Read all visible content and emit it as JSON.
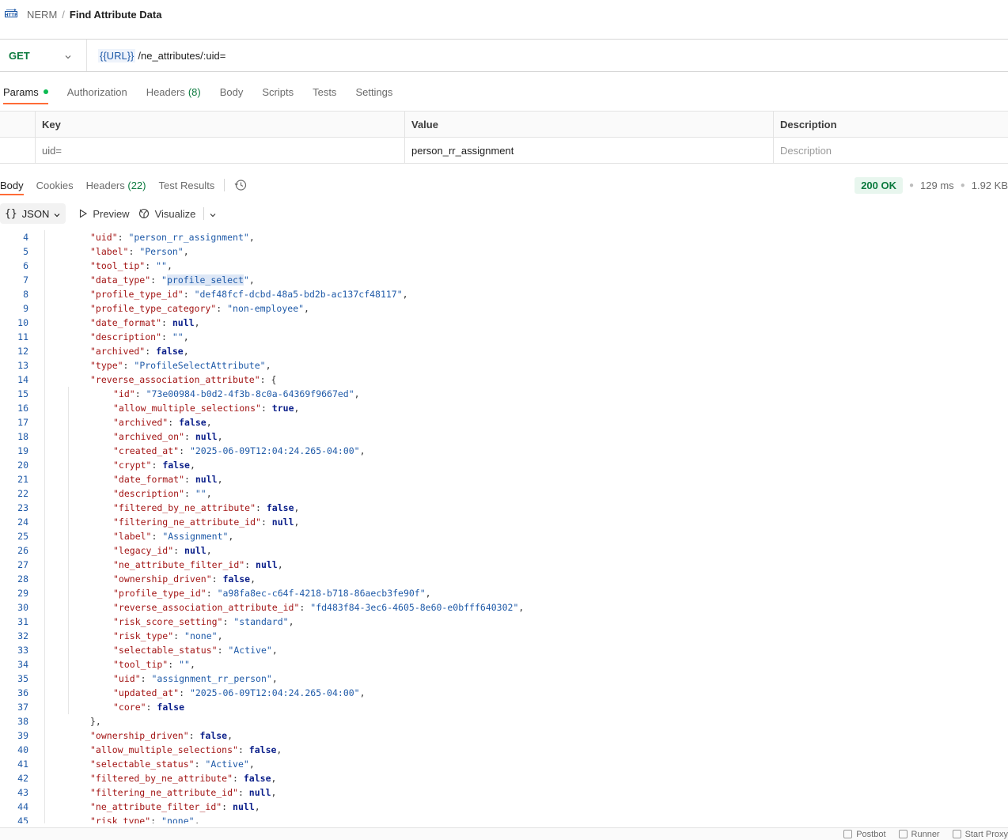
{
  "header": {
    "breadcrumb_root": "NERM",
    "breadcrumb_sep": "/",
    "title": "Find Attribute Data"
  },
  "request": {
    "method": "GET",
    "url_variable": "{{URL}}",
    "url_path": "/ne_attributes/:uid=",
    "tabs": [
      {
        "label": "Params",
        "count": "",
        "active": true,
        "dot": true
      },
      {
        "label": "Authorization",
        "count": ""
      },
      {
        "label": "Headers",
        "count": "(8)"
      },
      {
        "label": "Body",
        "count": ""
      },
      {
        "label": "Scripts",
        "count": ""
      },
      {
        "label": "Tests",
        "count": ""
      },
      {
        "label": "Settings",
        "count": ""
      }
    ]
  },
  "params": {
    "headers": {
      "key": "Key",
      "value": "Value",
      "description": "Description"
    },
    "rows": [
      {
        "key": "uid=",
        "value": "person_rr_assignment",
        "description_placeholder": "Description"
      }
    ]
  },
  "response": {
    "tabs": [
      {
        "label": "Body",
        "count": "",
        "active": true
      },
      {
        "label": "Cookies",
        "count": ""
      },
      {
        "label": "Headers",
        "count": "(22)"
      },
      {
        "label": "Test Results",
        "count": ""
      }
    ],
    "status": "200 OK",
    "time": "129 ms",
    "size": "1.92 KB",
    "format": "JSON",
    "preview_label": "Preview",
    "visualize_label": "Visualize"
  },
  "code_lines": [
    {
      "n": "4",
      "indent": 1,
      "tokens": [
        [
          "k",
          "\"uid\""
        ],
        [
          "p",
          ": "
        ],
        [
          "s",
          "\"person_rr_assignment\""
        ],
        [
          "p",
          ","
        ]
      ]
    },
    {
      "n": "5",
      "indent": 1,
      "tokens": [
        [
          "k",
          "\"label\""
        ],
        [
          "p",
          ": "
        ],
        [
          "s",
          "\"Person\""
        ],
        [
          "p",
          ","
        ]
      ]
    },
    {
      "n": "6",
      "indent": 1,
      "tokens": [
        [
          "k",
          "\"tool_tip\""
        ],
        [
          "p",
          ": "
        ],
        [
          "s",
          "\"\""
        ],
        [
          "p",
          ","
        ]
      ]
    },
    {
      "n": "7",
      "indent": 1,
      "tokens": [
        [
          "k",
          "\"data_type\""
        ],
        [
          "p",
          ": "
        ],
        [
          "s",
          "\""
        ],
        [
          "s hl",
          "profile_select"
        ],
        [
          "s",
          "\""
        ],
        [
          "p",
          ","
        ]
      ]
    },
    {
      "n": "8",
      "indent": 1,
      "tokens": [
        [
          "k",
          "\"profile_type_id\""
        ],
        [
          "p",
          ": "
        ],
        [
          "s",
          "\"def48fcf-dcbd-48a5-bd2b-ac137cf48117\""
        ],
        [
          "p",
          ","
        ]
      ]
    },
    {
      "n": "9",
      "indent": 1,
      "tokens": [
        [
          "k",
          "\"profile_type_category\""
        ],
        [
          "p",
          ": "
        ],
        [
          "s",
          "\"non-employee\""
        ],
        [
          "p",
          ","
        ]
      ]
    },
    {
      "n": "10",
      "indent": 1,
      "tokens": [
        [
          "k",
          "\"date_format\""
        ],
        [
          "p",
          ": "
        ],
        [
          "l",
          "null"
        ],
        [
          "p",
          ","
        ]
      ]
    },
    {
      "n": "11",
      "indent": 1,
      "tokens": [
        [
          "k",
          "\"description\""
        ],
        [
          "p",
          ": "
        ],
        [
          "s",
          "\"\""
        ],
        [
          "p",
          ","
        ]
      ]
    },
    {
      "n": "12",
      "indent": 1,
      "tokens": [
        [
          "k",
          "\"archived\""
        ],
        [
          "p",
          ": "
        ],
        [
          "l",
          "false"
        ],
        [
          "p",
          ","
        ]
      ]
    },
    {
      "n": "13",
      "indent": 1,
      "tokens": [
        [
          "k",
          "\"type\""
        ],
        [
          "p",
          ": "
        ],
        [
          "s",
          "\"ProfileSelectAttribute\""
        ],
        [
          "p",
          ","
        ]
      ]
    },
    {
      "n": "14",
      "indent": 1,
      "tokens": [
        [
          "k",
          "\"reverse_association_attribute\""
        ],
        [
          "p",
          ": {"
        ]
      ]
    },
    {
      "n": "15",
      "indent": 2,
      "tokens": [
        [
          "k",
          "\"id\""
        ],
        [
          "p",
          ": "
        ],
        [
          "s",
          "\"73e00984-b0d2-4f3b-8c0a-64369f9667ed\""
        ],
        [
          "p",
          ","
        ]
      ]
    },
    {
      "n": "16",
      "indent": 2,
      "tokens": [
        [
          "k",
          "\"allow_multiple_selections\""
        ],
        [
          "p",
          ": "
        ],
        [
          "l",
          "true"
        ],
        [
          "p",
          ","
        ]
      ]
    },
    {
      "n": "17",
      "indent": 2,
      "tokens": [
        [
          "k",
          "\"archived\""
        ],
        [
          "p",
          ": "
        ],
        [
          "l",
          "false"
        ],
        [
          "p",
          ","
        ]
      ]
    },
    {
      "n": "18",
      "indent": 2,
      "tokens": [
        [
          "k",
          "\"archived_on\""
        ],
        [
          "p",
          ": "
        ],
        [
          "l",
          "null"
        ],
        [
          "p",
          ","
        ]
      ]
    },
    {
      "n": "19",
      "indent": 2,
      "tokens": [
        [
          "k",
          "\"created_at\""
        ],
        [
          "p",
          ": "
        ],
        [
          "s",
          "\"2025-06-09T12:04:24.265-04:00\""
        ],
        [
          "p",
          ","
        ]
      ]
    },
    {
      "n": "20",
      "indent": 2,
      "tokens": [
        [
          "k",
          "\"crypt\""
        ],
        [
          "p",
          ": "
        ],
        [
          "l",
          "false"
        ],
        [
          "p",
          ","
        ]
      ]
    },
    {
      "n": "21",
      "indent": 2,
      "tokens": [
        [
          "k",
          "\"date_format\""
        ],
        [
          "p",
          ": "
        ],
        [
          "l",
          "null"
        ],
        [
          "p",
          ","
        ]
      ]
    },
    {
      "n": "22",
      "indent": 2,
      "tokens": [
        [
          "k",
          "\"description\""
        ],
        [
          "p",
          ": "
        ],
        [
          "s",
          "\"\""
        ],
        [
          "p",
          ","
        ]
      ]
    },
    {
      "n": "23",
      "indent": 2,
      "tokens": [
        [
          "k",
          "\"filtered_by_ne_attribute\""
        ],
        [
          "p",
          ": "
        ],
        [
          "l",
          "false"
        ],
        [
          "p",
          ","
        ]
      ]
    },
    {
      "n": "24",
      "indent": 2,
      "tokens": [
        [
          "k",
          "\"filtering_ne_attribute_id\""
        ],
        [
          "p",
          ": "
        ],
        [
          "l",
          "null"
        ],
        [
          "p",
          ","
        ]
      ]
    },
    {
      "n": "25",
      "indent": 2,
      "tokens": [
        [
          "k",
          "\"label\""
        ],
        [
          "p",
          ": "
        ],
        [
          "s",
          "\"Assignment\""
        ],
        [
          "p",
          ","
        ]
      ]
    },
    {
      "n": "26",
      "indent": 2,
      "tokens": [
        [
          "k",
          "\"legacy_id\""
        ],
        [
          "p",
          ": "
        ],
        [
          "l",
          "null"
        ],
        [
          "p",
          ","
        ]
      ]
    },
    {
      "n": "27",
      "indent": 2,
      "tokens": [
        [
          "k",
          "\"ne_attribute_filter_id\""
        ],
        [
          "p",
          ": "
        ],
        [
          "l",
          "null"
        ],
        [
          "p",
          ","
        ]
      ]
    },
    {
      "n": "28",
      "indent": 2,
      "tokens": [
        [
          "k",
          "\"ownership_driven\""
        ],
        [
          "p",
          ": "
        ],
        [
          "l",
          "false"
        ],
        [
          "p",
          ","
        ]
      ]
    },
    {
      "n": "29",
      "indent": 2,
      "tokens": [
        [
          "k",
          "\"profile_type_id\""
        ],
        [
          "p",
          ": "
        ],
        [
          "s",
          "\"a98fa8ec-c64f-4218-b718-86aecb3fe90f\""
        ],
        [
          "p",
          ","
        ]
      ]
    },
    {
      "n": "30",
      "indent": 2,
      "tokens": [
        [
          "k",
          "\"reverse_association_attribute_id\""
        ],
        [
          "p",
          ": "
        ],
        [
          "s",
          "\"fd483f84-3ec6-4605-8e60-e0bfff640302\""
        ],
        [
          "p",
          ","
        ]
      ]
    },
    {
      "n": "31",
      "indent": 2,
      "tokens": [
        [
          "k",
          "\"risk_score_setting\""
        ],
        [
          "p",
          ": "
        ],
        [
          "s",
          "\"standard\""
        ],
        [
          "p",
          ","
        ]
      ]
    },
    {
      "n": "32",
      "indent": 2,
      "tokens": [
        [
          "k",
          "\"risk_type\""
        ],
        [
          "p",
          ": "
        ],
        [
          "s",
          "\"none\""
        ],
        [
          "p",
          ","
        ]
      ]
    },
    {
      "n": "33",
      "indent": 2,
      "tokens": [
        [
          "k",
          "\"selectable_status\""
        ],
        [
          "p",
          ": "
        ],
        [
          "s",
          "\"Active\""
        ],
        [
          "p",
          ","
        ]
      ]
    },
    {
      "n": "34",
      "indent": 2,
      "tokens": [
        [
          "k",
          "\"tool_tip\""
        ],
        [
          "p",
          ": "
        ],
        [
          "s",
          "\"\""
        ],
        [
          "p",
          ","
        ]
      ]
    },
    {
      "n": "35",
      "indent": 2,
      "tokens": [
        [
          "k",
          "\"uid\""
        ],
        [
          "p",
          ": "
        ],
        [
          "s",
          "\"assignment_rr_person\""
        ],
        [
          "p",
          ","
        ]
      ]
    },
    {
      "n": "36",
      "indent": 2,
      "tokens": [
        [
          "k",
          "\"updated_at\""
        ],
        [
          "p",
          ": "
        ],
        [
          "s",
          "\"2025-06-09T12:04:24.265-04:00\""
        ],
        [
          "p",
          ","
        ]
      ]
    },
    {
      "n": "37",
      "indent": 2,
      "tokens": [
        [
          "k",
          "\"core\""
        ],
        [
          "p",
          ": "
        ],
        [
          "l",
          "false"
        ]
      ]
    },
    {
      "n": "38",
      "indent": 1,
      "tokens": [
        [
          "p",
          "},"
        ]
      ]
    },
    {
      "n": "39",
      "indent": 1,
      "tokens": [
        [
          "k",
          "\"ownership_driven\""
        ],
        [
          "p",
          ": "
        ],
        [
          "l",
          "false"
        ],
        [
          "p",
          ","
        ]
      ]
    },
    {
      "n": "40",
      "indent": 1,
      "tokens": [
        [
          "k",
          "\"allow_multiple_selections\""
        ],
        [
          "p",
          ": "
        ],
        [
          "l",
          "false"
        ],
        [
          "p",
          ","
        ]
      ]
    },
    {
      "n": "41",
      "indent": 1,
      "tokens": [
        [
          "k",
          "\"selectable_status\""
        ],
        [
          "p",
          ": "
        ],
        [
          "s",
          "\"Active\""
        ],
        [
          "p",
          ","
        ]
      ]
    },
    {
      "n": "42",
      "indent": 1,
      "tokens": [
        [
          "k",
          "\"filtered_by_ne_attribute\""
        ],
        [
          "p",
          ": "
        ],
        [
          "l",
          "false"
        ],
        [
          "p",
          ","
        ]
      ]
    },
    {
      "n": "43",
      "indent": 1,
      "tokens": [
        [
          "k",
          "\"filtering_ne_attribute_id\""
        ],
        [
          "p",
          ": "
        ],
        [
          "l",
          "null"
        ],
        [
          "p",
          ","
        ]
      ]
    },
    {
      "n": "44",
      "indent": 1,
      "tokens": [
        [
          "k",
          "\"ne_attribute_filter_id\""
        ],
        [
          "p",
          ": "
        ],
        [
          "l",
          "null"
        ],
        [
          "p",
          ","
        ]
      ]
    },
    {
      "n": "45",
      "indent": 1,
      "tokens": [
        [
          "k",
          "\"risk_type\""
        ],
        [
          "p",
          ": "
        ],
        [
          "s",
          "\"none\""
        ],
        [
          "p",
          ","
        ]
      ]
    }
  ],
  "footer": {
    "items": [
      "Postbot",
      "Runner",
      "Start Proxy"
    ]
  }
}
